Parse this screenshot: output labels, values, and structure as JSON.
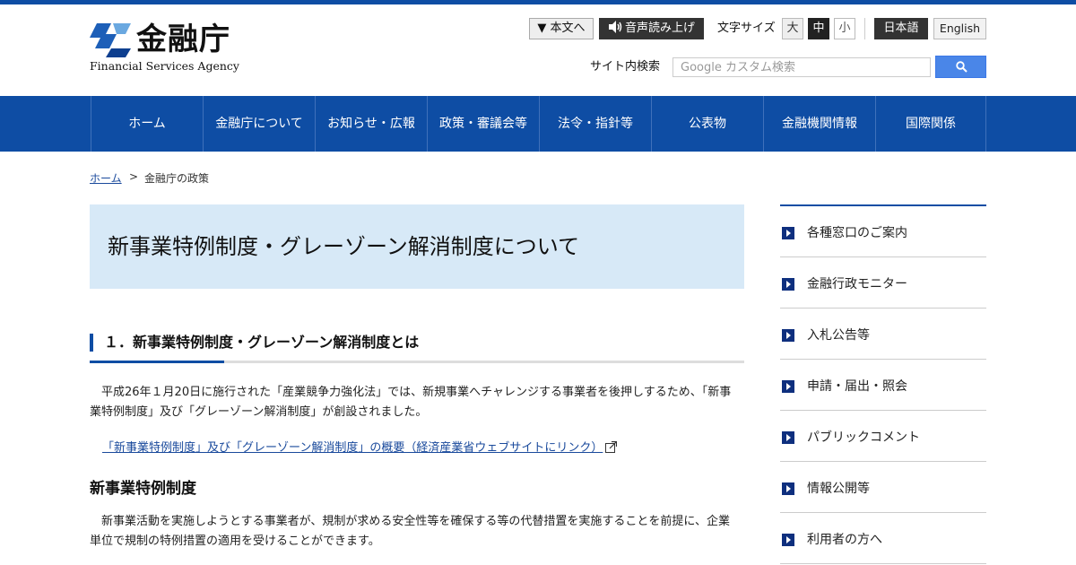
{
  "header": {
    "logo_ja": "金融庁",
    "logo_en": "Financial Services Agency",
    "skip_label": "▼ 本文へ",
    "speech_label": "音声読み上げ",
    "font_size_label": "文字サイズ",
    "font_sizes": [
      "大",
      "中",
      "小"
    ],
    "font_size_selected": "中",
    "lang_ja": "日本語",
    "lang_en": "English",
    "search_label": "サイト内検索",
    "search_placeholder": "Google カスタム検索",
    "colors": {
      "brand": "#0e4da4",
      "search_button": "#4a86e8"
    }
  },
  "nav": {
    "items": [
      "ホーム",
      "金融庁について",
      "お知らせ・広報",
      "政策・審議会等",
      "法令・指針等",
      "公表物",
      "金融機関情報",
      "国際関係"
    ]
  },
  "breadcrumb": {
    "home": "ホーム",
    "separator": ">",
    "current": "金融庁の政策"
  },
  "main": {
    "title": "新事業特例制度・グレーゾーン解消制度について",
    "section1_heading": "１．新事業特例制度・グレーゾーン解消制度とは",
    "section1_text": "　平成26年１月20日に施行された「産業競争力強化法」では、新規事業へチャレンジする事業者を後押しするため、「新事業特例制度」及び「グレーゾーン解消制度」が創設されました。",
    "section1_link": "「新事業特例制度」及び「グレーゾーン解消制度」の概要（経済産業省ウェブサイトにリンク）",
    "sub_heading": "新事業特例制度",
    "sub_text": "　新事業活動を実施しようとする事業者が、規制が求める安全性等を確保する等の代替措置を実施することを前提に、企業単位で規制の特例措置の適用を受けることができます。"
  },
  "sidebar": {
    "items": [
      "各種窓口のご案内",
      "金融行政モニター",
      "入札公告等",
      "申請・届出・照会",
      "パブリックコメント",
      "情報公開等",
      "利用者の方へ"
    ]
  }
}
